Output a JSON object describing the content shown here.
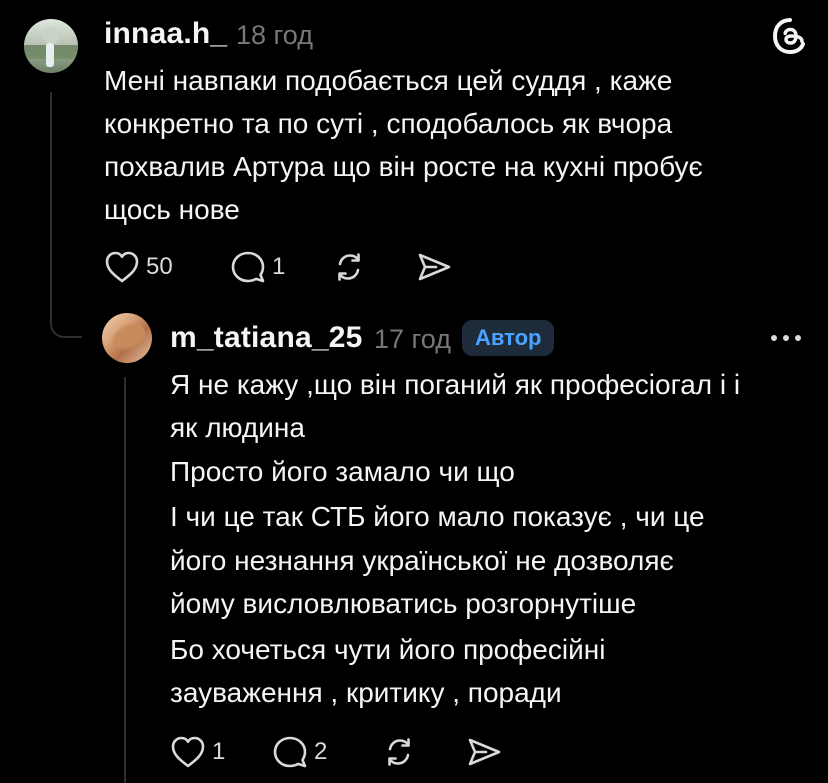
{
  "app": {
    "brand_icon": "threads-logo-icon"
  },
  "comments": [
    {
      "username": "innaa.h_",
      "time": "18 год",
      "lines": [
        "Мені навпаки подобається цей суддя , каже",
        "конкретно та по суті , сподобалось як вчора",
        "похвалив Артура що він росте на кухні пробує",
        "щось нове"
      ],
      "likes": "50",
      "replies": "1"
    },
    {
      "username": "m_tatiana_25",
      "time": "17 год",
      "badge": "Автор",
      "lines": [
        "Я не кажу ,що він поганий як професіогал і і",
        "як людина",
        "Просто його замало чи що",
        "І чи це так СТБ його мало показує , чи це",
        "його незнання української не дозволяє",
        "йому висловлюватись розгорнутіше",
        "Бо хочеться чути його професійні",
        "зауваження , критику , поради"
      ],
      "likes": "1",
      "replies": "2"
    }
  ],
  "colors": {
    "background": "#000000",
    "text": "#f3f5f7",
    "muted": "#777777",
    "badge_text": "#4aa4ff",
    "badge_bg": "#1d2b3a"
  }
}
